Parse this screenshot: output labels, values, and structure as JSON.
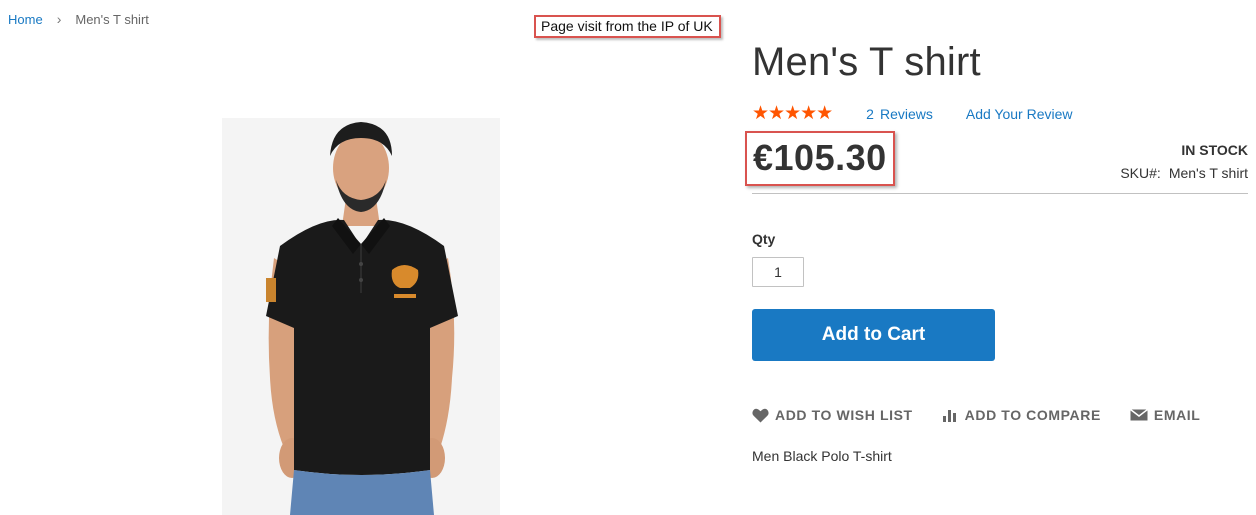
{
  "breadcrumb": {
    "home": "Home",
    "current": "Men's T shirt"
  },
  "annotation": {
    "text": "Page visit from the IP of UK"
  },
  "product": {
    "title": "Men's T shirt",
    "rating_stars": 5,
    "stars_text": "★★★★★",
    "reviews_count": "2",
    "reviews_label": "Reviews",
    "add_review_label": "Add Your Review",
    "price": "€105.30",
    "stock_status": "In stock",
    "sku_label": "SKU#:",
    "sku_value": "Men's T shirt",
    "qty_label": "Qty",
    "qty_value": "1",
    "add_to_cart_label": "Add to Cart",
    "description": "Men Black Polo T-shirt"
  },
  "actions": {
    "wishlist": "Add to Wish List",
    "compare": "Add to Compare",
    "email": "Email"
  },
  "icons": {
    "wishlist": "heart-icon",
    "compare": "bar-chart-icon",
    "email": "envelope-icon"
  },
  "colors": {
    "link": "#1979c3",
    "stars": "#ff5501",
    "button": "#1979c3",
    "highlight_border": "#d9534f"
  }
}
